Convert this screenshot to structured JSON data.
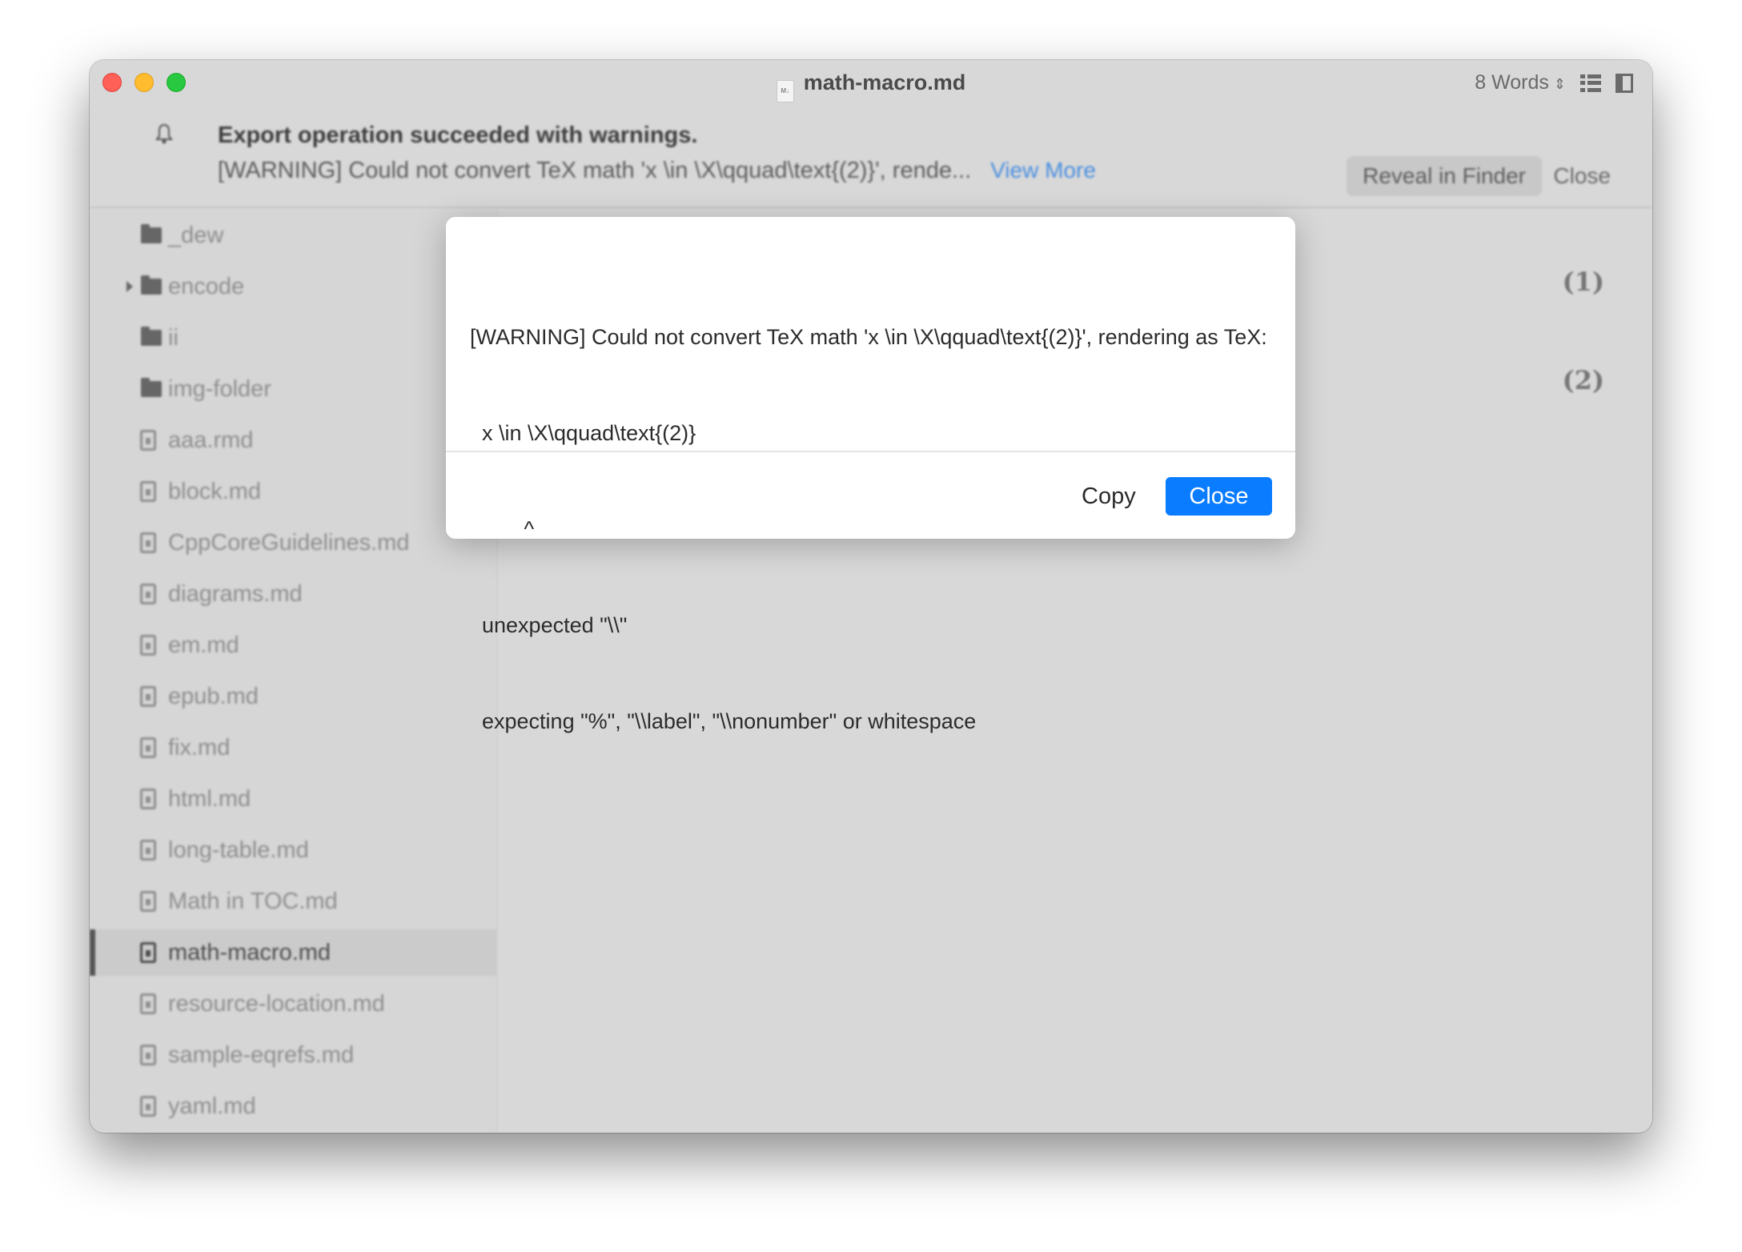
{
  "window": {
    "title": "math-macro.md",
    "file_badge": "M↓",
    "word_count": "8 Words",
    "word_count_chevron": "⌃⌄"
  },
  "notification": {
    "title": "Export operation succeeded with warnings.",
    "message": "[WARNING] Could not convert TeX math 'x \\in \\X\\qquad\\text{(2)}', rende...",
    "view_more": "View More",
    "reveal_button": "Reveal in Finder",
    "close_button": "Close"
  },
  "sidebar": {
    "items": [
      {
        "label": "_dew",
        "type": "folder",
        "expandable": false,
        "selected": false
      },
      {
        "label": "encode",
        "type": "folder",
        "expandable": true,
        "selected": false
      },
      {
        "label": "ii",
        "type": "folder",
        "expandable": false,
        "selected": false
      },
      {
        "label": "img-folder",
        "type": "folder",
        "expandable": false,
        "selected": false
      },
      {
        "label": "aaa.rmd",
        "type": "file",
        "selected": false
      },
      {
        "label": "block.md",
        "type": "file",
        "selected": false
      },
      {
        "label": "CppCoreGuidelines.md",
        "type": "file",
        "selected": false
      },
      {
        "label": "diagrams.md",
        "type": "file",
        "selected": false
      },
      {
        "label": "em.md",
        "type": "file",
        "selected": false
      },
      {
        "label": "epub.md",
        "type": "file",
        "selected": false
      },
      {
        "label": "fix.md",
        "type": "file",
        "selected": false
      },
      {
        "label": "html.md",
        "type": "file",
        "selected": false
      },
      {
        "label": "long-table.md",
        "type": "file",
        "selected": false
      },
      {
        "label": "Math in TOC.md",
        "type": "file",
        "selected": false
      },
      {
        "label": "math-macro.md",
        "type": "file",
        "selected": true
      },
      {
        "label": "resource-location.md",
        "type": "file",
        "selected": false
      },
      {
        "label": "sample-eqrefs.md",
        "type": "file",
        "selected": false
      },
      {
        "label": "yaml.md",
        "type": "file",
        "selected": false
      }
    ]
  },
  "editor": {
    "equation_numbers": [
      "(1)",
      "(2)"
    ]
  },
  "dialog": {
    "lines": [
      "[WARNING] Could not convert TeX math 'x \\in \\X\\qquad\\text{(2)}', rendering as TeX:",
      "  x \\in \\X\\qquad\\text{(2)}",
      "         ^",
      "  unexpected \"\\\\\"",
      "  expecting \"%\", \"\\\\label\", \"\\\\nonumber\" or whitespace"
    ],
    "copy_button": "Copy",
    "close_button": "Close",
    "accent_color": "#0a7cff"
  }
}
